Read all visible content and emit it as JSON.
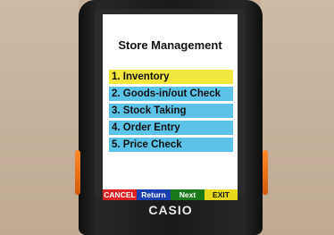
{
  "screen": {
    "title": "Store Management",
    "menu": [
      {
        "label": "1. Inventory",
        "selected": true
      },
      {
        "label": "2. Goods-in/out Check",
        "selected": false
      },
      {
        "label": "3. Stock Taking",
        "selected": false
      },
      {
        "label": "4. Order Entry",
        "selected": false
      },
      {
        "label": "5. Price Check",
        "selected": false
      }
    ],
    "softkeys": {
      "cancel": "CANCEL",
      "return": "Return",
      "next": "Next",
      "exit": "EXIT"
    }
  },
  "device": {
    "brand": "CASIO"
  },
  "colors": {
    "selected_item": "#f2e73e",
    "menu_item": "#5cc3e8",
    "cancel": "#e02020",
    "return": "#1a3fb0",
    "next": "#1a7a1a",
    "exit": "#e6d81a",
    "side_button": "#ff8a2a"
  }
}
